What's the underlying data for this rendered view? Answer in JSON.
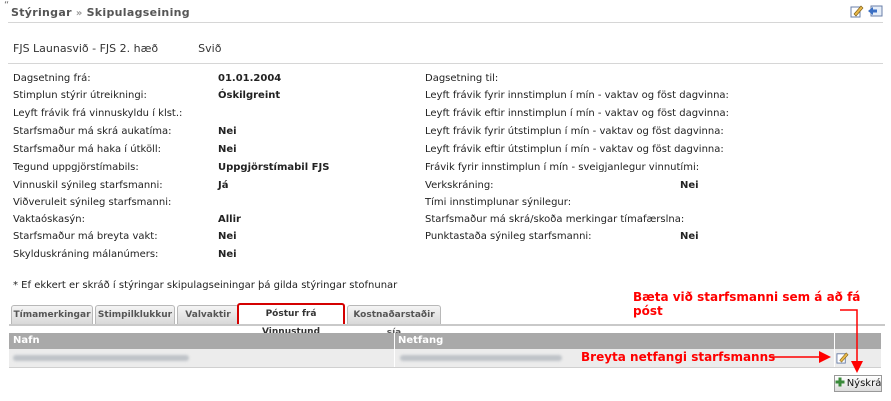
{
  "breadcrumb": {
    "item1": "Stýringar",
    "sep": "»",
    "item2": "Skipulagseining"
  },
  "header": {
    "unit": "FJS Launasvið - FJS 2. hæð",
    "type": "Svið"
  },
  "left_fields": [
    {
      "label": "Dagsetning frá:",
      "value": "01.01.2004"
    },
    {
      "label": "Stimplun stýrir útreikningi:",
      "value": "Óskilgreint"
    },
    {
      "label": "Leyft frávik frá vinnuskyldu í klst.:",
      "value": ""
    },
    {
      "label": "Starfsmaður má skrá aukatíma:",
      "value": "Nei"
    },
    {
      "label": "Starfsmaður má haka í útköll:",
      "value": "Nei"
    },
    {
      "label": "Tegund uppgjörstímabils:",
      "value": "Uppgjörstímabil FJS"
    },
    {
      "label": "Vinnuskil sýnileg starfsmanni:",
      "value": "Já"
    },
    {
      "label": "Viðveruleit sýnileg starfsmanni:",
      "value": ""
    },
    {
      "label": "Vaktaóskasýn:",
      "value": "Allir"
    },
    {
      "label": "Starfsmaður má breyta vakt:",
      "value": "Nei"
    },
    {
      "label": "Skylduskráning málanúmers:",
      "value": "Nei"
    }
  ],
  "right_fields": [
    {
      "label": "Dagsetning til:",
      "value": ""
    },
    {
      "label": "Leyft frávik fyrir innstimplun í mín - vaktav og föst dagvinna:",
      "value": ""
    },
    {
      "label": "Leyft frávik eftir innstimplun í mín - vaktav og föst dagvinna:",
      "value": ""
    },
    {
      "label": "Leyft frávik fyrir útstimplun í mín - vaktav og föst dagvinna:",
      "value": ""
    },
    {
      "label": "Leyft frávik eftir útstimplun í mín - vaktav og föst dagvinna:",
      "value": ""
    },
    {
      "label": "Frávik fyrir innstimplun í mín - sveigjanlegur vinnutími:",
      "value": ""
    },
    {
      "label": "Verkskráning:",
      "value": "Nei"
    },
    {
      "label": "Tími innstimplunar sýnilegur:",
      "value": ""
    },
    {
      "label": "Starfsmaður má skrá/skoða merkingar tímafærslna:",
      "value": ""
    },
    {
      "label": "Punktastaða sýnileg starfsmanni:",
      "value": "Nei"
    }
  ],
  "note": "* Ef ekkert er skráð í stýringar skipulagseiningar þá gilda stýringar stofnunar",
  "tabs": [
    "Tímamerkingar",
    "Stimpilklukkur",
    "Valvaktir",
    "Póstur frá Vinnustund",
    "Kostnaðarstaðir sía"
  ],
  "grid": {
    "col_name": "Nafn",
    "col_email": "Netfang"
  },
  "add_button": "Nýskrá",
  "annotations": {
    "add": "Bæta við starfsmanni sem á að fá póst",
    "edit": "Breyta netfangi starfsmanns"
  },
  "colors": {
    "annotation": "#ff0000",
    "active_tab_border": "#d40000",
    "grid_header": "#a9a9a9"
  }
}
